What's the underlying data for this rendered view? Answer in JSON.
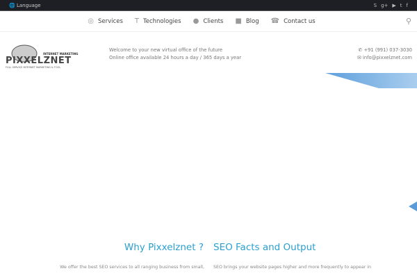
{
  "topbar": {
    "language": "Language",
    "social": [
      "skype-icon",
      "google-plus-icon",
      "youtube-icon",
      "twitter-icon",
      "facebook-icon"
    ]
  },
  "nav": {
    "items": [
      {
        "label": "Services",
        "icon": "antenna-icon"
      },
      {
        "label": "Technologies",
        "icon": "text-icon"
      },
      {
        "label": "Clients",
        "icon": "user-icon"
      },
      {
        "label": "Blog",
        "icon": "blogger-icon"
      },
      {
        "label": "Contact us",
        "icon": "phone-icon"
      }
    ]
  },
  "header": {
    "logo_text": "PIXXELZNET",
    "logo_tag": "INTERNET MARKETING",
    "logo_sub": "FULL SERVICE INTERNET MARKETING & TOOL",
    "welcome1": "Welcome to your new virtual office of the future",
    "welcome2": "Online office available 24 hours a day / 365 days a year",
    "phone": "+91 (991) 037-3030",
    "email": "info@pixxelznet.com"
  },
  "sections": {
    "why_title": "Why Pixxelznet ?",
    "why_text": "We offer the best SEO services to all ranging business from small,",
    "seo_title": "SEO Facts and Output",
    "seo_text": "SEO brings your website pages higher and more frequently to appear in"
  }
}
